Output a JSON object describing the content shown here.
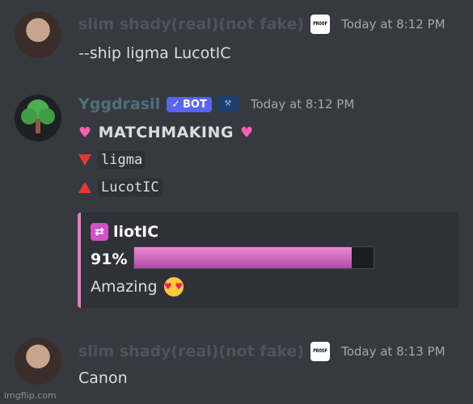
{
  "messages": [
    {
      "username": "slim shady(real)(not fake)",
      "badge_text": "PROOF",
      "timestamp": "Today at 8:12 PM",
      "text": "--ship ligma LucotIC"
    },
    {
      "username": "Yggdrasil",
      "bot_tag": "BOT",
      "timestamp": "Today at 8:12 PM",
      "title": "MATCHMAKING",
      "name1": "ligma",
      "name2": "LucotIC",
      "embed": {
        "title": "liotIC",
        "percent_label": "91%",
        "percent_value": 0.91,
        "verdict": "Amazing"
      }
    },
    {
      "username": "slim shady(real)(not fake)",
      "badge_text": "PROOF",
      "timestamp": "Today at 8:13 PM",
      "text": "Canon"
    }
  ],
  "watermark": "imgflip.com",
  "colors": {
    "bot_tag": "#5865f2",
    "embed_accent": "#e67ec4",
    "bar_fill": "#d86bc3"
  },
  "icons": [
    "heart-icon",
    "triangle-down-icon",
    "triangle-up-icon",
    "shuffle-icon",
    "heart-eyes-icon"
  ]
}
